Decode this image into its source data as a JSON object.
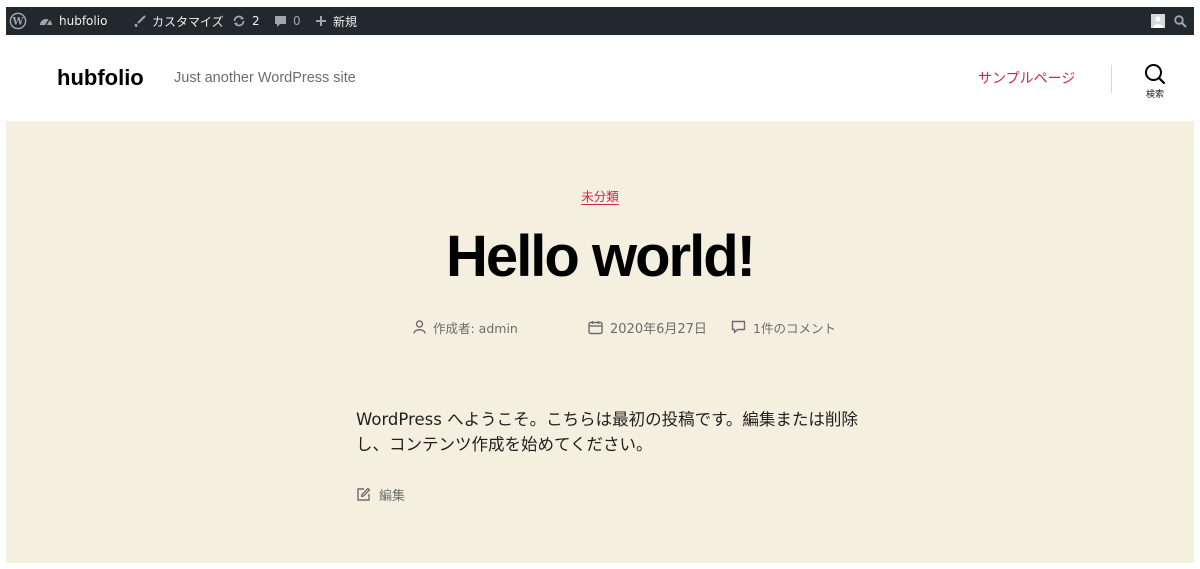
{
  "admin_bar": {
    "site_name": "hubfolio",
    "customize": "カスタマイズ",
    "updates_count": "2",
    "comments_count": "0",
    "new_label": "新規"
  },
  "header": {
    "site_title": "hubfolio",
    "site_description": "Just another WordPress site",
    "nav_item": "サンプルページ",
    "search_label": "検索"
  },
  "post": {
    "category": "未分類",
    "title": "Hello world!",
    "author": "作成者: admin",
    "date": "2020年6月27日",
    "comments": "1件のコメント",
    "content": "WordPress へようこそ。こちらは最初の投稿です。編集または削除し、コンテンツ作成を始めてください。",
    "edit": "編集"
  },
  "colors": {
    "admin_bar_bg": "#23282d",
    "accent": "#cd2653",
    "main_bg": "#f5efe0"
  }
}
